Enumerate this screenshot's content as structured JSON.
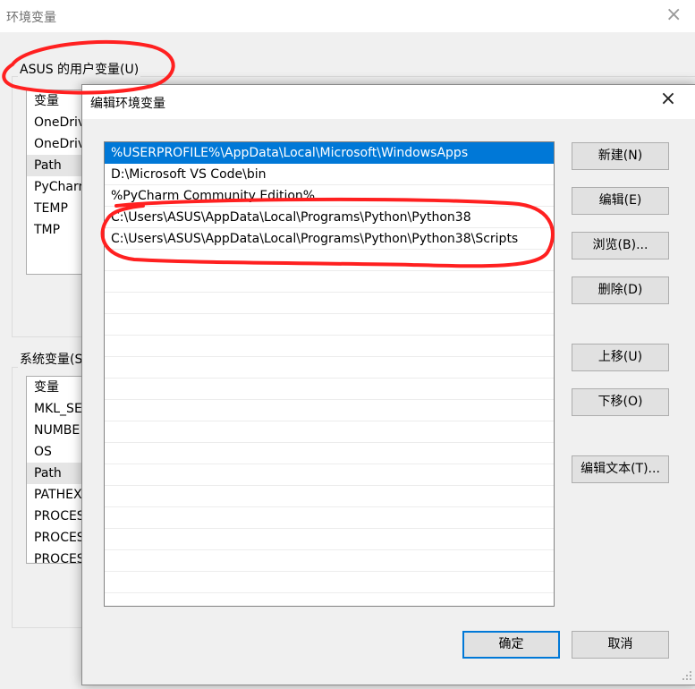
{
  "window": {
    "title": "环境变量",
    "close_glyph": "×"
  },
  "user_vars": {
    "group_label": "ASUS 的用户变量(U)",
    "header": "变量",
    "rows": [
      "OneDrive",
      "OneDrive",
      "Path",
      "PyCharm",
      "TEMP",
      "TMP"
    ]
  },
  "system_vars": {
    "group_label": "系统变量(S)",
    "header": "变量",
    "rows": [
      "MKL_SE",
      "NUMBE",
      "OS",
      "Path",
      "PATHEX",
      "PROCES",
      "PROCES",
      "PROCES"
    ]
  },
  "dialog": {
    "title": "编辑环境变量",
    "close_glyph": "×",
    "paths": [
      "%USERPROFILE%\\AppData\\Local\\Microsoft\\WindowsApps",
      "D:\\Microsoft VS Code\\bin",
      "%PyCharm Community Edition%",
      "C:\\Users\\ASUS\\AppData\\Local\\Programs\\Python\\Python38",
      "C:\\Users\\ASUS\\AppData\\Local\\Programs\\Python\\Python38\\Scripts"
    ],
    "selected_index": 0,
    "buttons": {
      "new": "新建(N)",
      "edit": "编辑(E)",
      "browse": "浏览(B)...",
      "delete": "删除(D)",
      "move_up": "上移(U)",
      "move_down": "下移(O)",
      "edit_text": "编辑文本(T)...",
      "ok": "确定",
      "cancel": "取消"
    }
  },
  "colors": {
    "selection": "#0078d7",
    "annotation": "#ff2020",
    "dialog_bg": "#f0f0f0",
    "button_bg": "#e1e1e1"
  }
}
